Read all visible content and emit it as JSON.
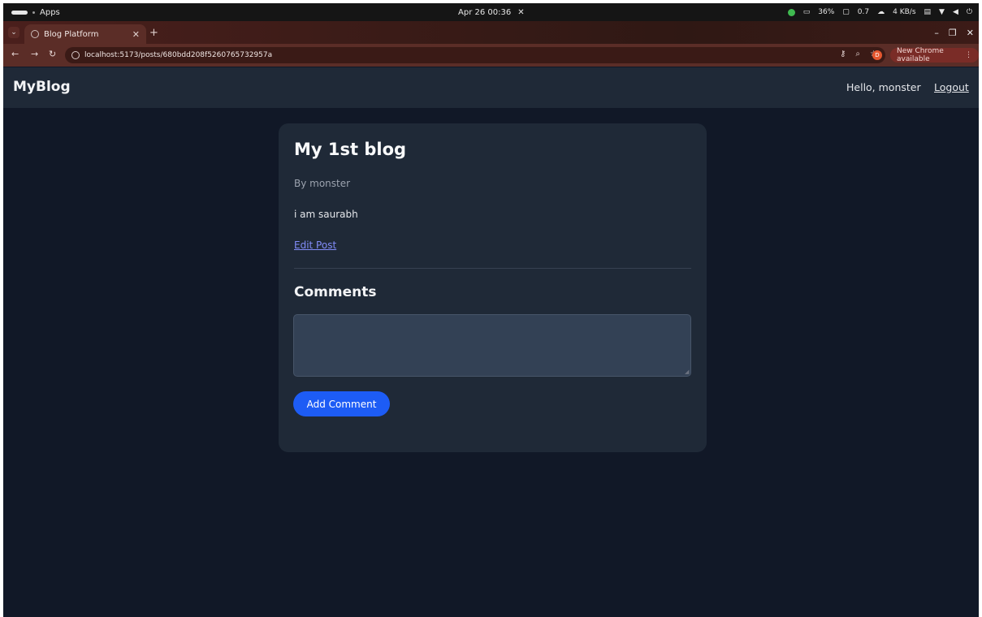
{
  "os": {
    "activities_label": "Apps",
    "clock": "Apr 26  00:36",
    "battery": "36%",
    "cpu": "0.7",
    "network": "4 KB/s"
  },
  "browser": {
    "tab_title": "Blog Platform",
    "url": "localhost:5173/posts/680bdd208f5260765732957a",
    "update_label": "New Chrome available",
    "profile_initial": "D"
  },
  "navbar": {
    "brand": "MyBlog",
    "greeting": "Hello, monster",
    "logout_label": "Logout"
  },
  "post": {
    "title": "My 1st blog",
    "author_line": "By monster",
    "content": "i am saurabh",
    "edit_label": "Edit Post"
  },
  "comments": {
    "heading": "Comments",
    "input_value": "",
    "submit_label": "Add Comment"
  },
  "colors": {
    "page_bg": "#111827",
    "card_bg": "#1f2937",
    "accent": "#1d5cf5",
    "link": "#818cf8"
  }
}
